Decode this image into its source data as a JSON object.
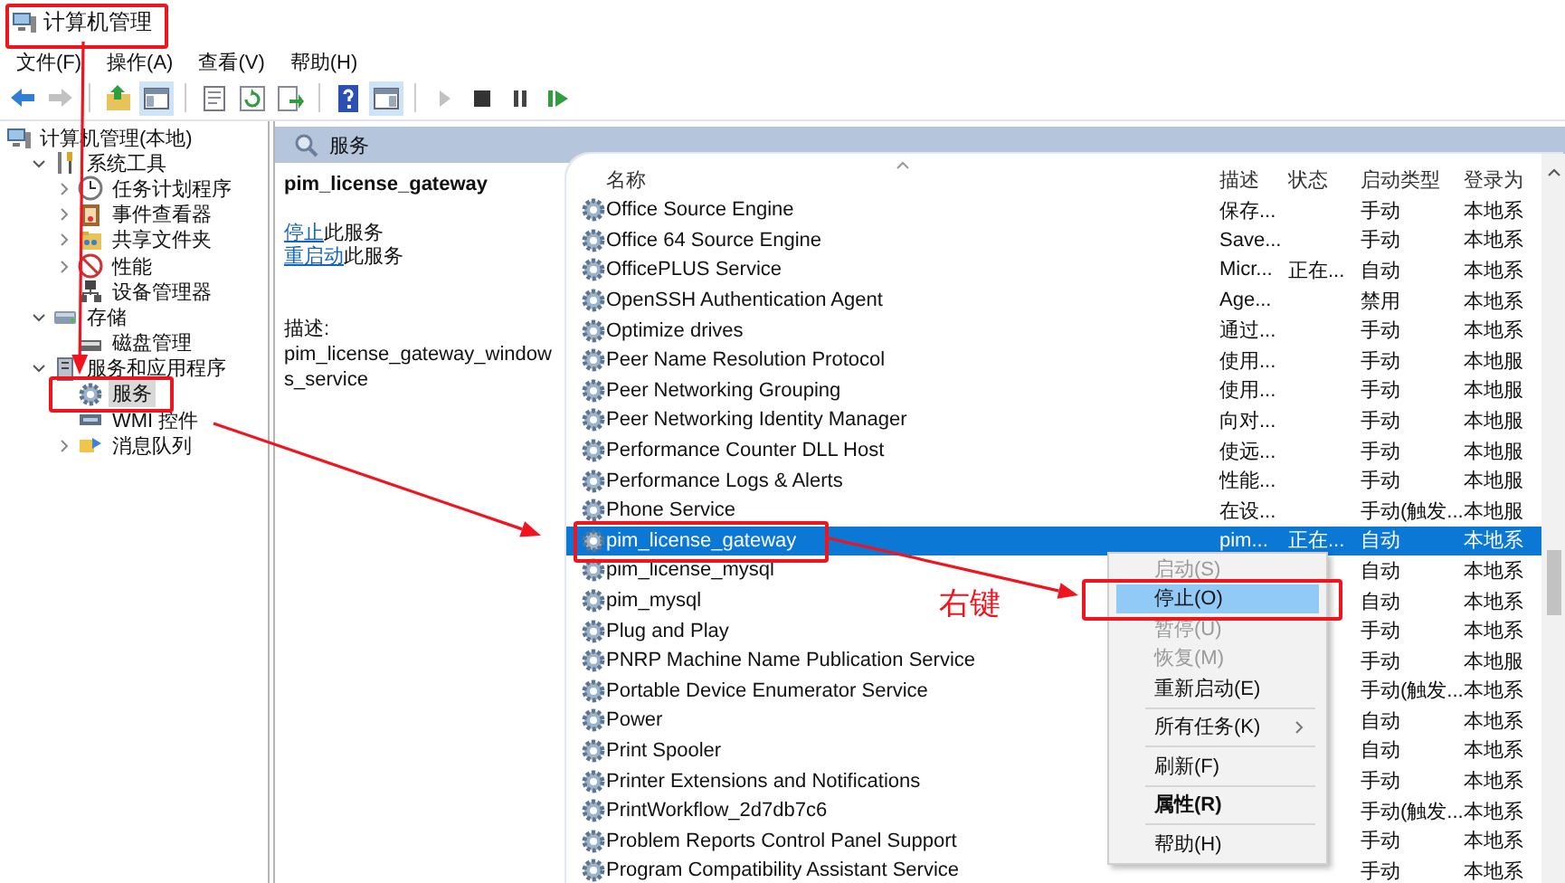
{
  "window": {
    "title": "计算机管理"
  },
  "menus": [
    "文件(F)",
    "操作(A)",
    "查看(V)",
    "帮助(H)"
  ],
  "toolbar": [
    {
      "kind": "button",
      "pressed": false,
      "disabled": false
    },
    {
      "kind": "button",
      "pressed": false,
      "disabled": true
    },
    {
      "kind": "separator"
    },
    {
      "kind": "button",
      "pressed": false,
      "disabled": false
    },
    {
      "kind": "button",
      "pressed": true,
      "disabled": false
    },
    {
      "kind": "separator"
    },
    {
      "kind": "button",
      "pressed": false,
      "disabled": false
    },
    {
      "kind": "button",
      "pressed": false,
      "disabled": false
    },
    {
      "kind": "button",
      "pressed": false,
      "disabled": false
    },
    {
      "kind": "separator"
    },
    {
      "kind": "button",
      "pressed": false,
      "disabled": false
    },
    {
      "kind": "button",
      "pressed": true,
      "disabled": false
    },
    {
      "kind": "separator"
    },
    {
      "kind": "button",
      "pressed": false,
      "disabled": true
    },
    {
      "kind": "button",
      "pressed": false,
      "disabled": false
    },
    {
      "kind": "button",
      "pressed": false,
      "disabled": false
    },
    {
      "kind": "button",
      "pressed": false,
      "disabled": false
    }
  ],
  "tree": [
    {
      "label": "计算机管理(本地)",
      "selected": false,
      "children": [
        {
          "label": "系统工具",
          "selected": false,
          "expanded": true,
          "children": [
            {
              "label": "任务计划程序",
              "selected": false,
              "expanded": false
            },
            {
              "label": "事件查看器",
              "selected": false,
              "expanded": false
            },
            {
              "label": "共享文件夹",
              "selected": false,
              "expanded": false
            },
            {
              "label": "性能",
              "selected": false,
              "expanded": false
            },
            {
              "label": "设备管理器",
              "selected": false
            }
          ]
        },
        {
          "label": "存储",
          "selected": false,
          "expanded": true,
          "children": [
            {
              "label": "磁盘管理",
              "selected": false
            }
          ]
        },
        {
          "label": "服务和应用程序",
          "selected": false,
          "expanded": true,
          "children": [
            {
              "label": "服务",
              "selected": true
            },
            {
              "label": "WMI 控件",
              "selected": false
            },
            {
              "label": "消息队列",
              "selected": false,
              "expanded": false
            }
          ]
        }
      ]
    }
  ],
  "pane": {
    "title": "服务",
    "info": {
      "service_name": "pim_license_gateway",
      "actions": [
        {
          "link": "停止",
          "text": "此服务"
        },
        {
          "link": "重启动",
          "text": "此服务"
        }
      ],
      "description_label": "描述:",
      "description": "pim_license_gateway_windows_service"
    }
  },
  "table": {
    "columns": [
      "名称",
      "描述",
      "状态",
      "启动类型",
      "登录为"
    ],
    "rows": [
      {
        "name": "Office  Source Engine",
        "description": "保存...",
        "status": "",
        "startup": "手动",
        "logon": "本地系",
        "selected": false
      },
      {
        "name": "Office 64 Source Engine",
        "description": "Save...",
        "status": "",
        "startup": "手动",
        "logon": "本地系",
        "selected": false
      },
      {
        "name": "OfficePLUS Service",
        "description": "Micr...",
        "status": "正在...",
        "startup": "自动",
        "logon": "本地系",
        "selected": false
      },
      {
        "name": "OpenSSH Authentication Agent",
        "description": "Age...",
        "status": "",
        "startup": "禁用",
        "logon": "本地系",
        "selected": false
      },
      {
        "name": "Optimize drives",
        "description": "通过...",
        "status": "",
        "startup": "手动",
        "logon": "本地系",
        "selected": false
      },
      {
        "name": "Peer Name Resolution Protocol",
        "description": "使用...",
        "status": "",
        "startup": "手动",
        "logon": "本地服",
        "selected": false
      },
      {
        "name": "Peer Networking Grouping",
        "description": "使用...",
        "status": "",
        "startup": "手动",
        "logon": "本地服",
        "selected": false
      },
      {
        "name": "Peer Networking Identity Manager",
        "description": "向对...",
        "status": "",
        "startup": "手动",
        "logon": "本地服",
        "selected": false
      },
      {
        "name": "Performance Counter DLL Host",
        "description": "使远...",
        "status": "",
        "startup": "手动",
        "logon": "本地服",
        "selected": false
      },
      {
        "name": "Performance Logs & Alerts",
        "description": "性能...",
        "status": "",
        "startup": "手动",
        "logon": "本地服",
        "selected": false
      },
      {
        "name": "Phone Service",
        "description": "在设...",
        "status": "",
        "startup": "手动(触发...",
        "logon": "本地服",
        "selected": false
      },
      {
        "name": "pim_license_gateway",
        "description": "pim...",
        "status": "正在...",
        "startup": "自动",
        "logon": "本地系",
        "selected": true
      },
      {
        "name": "pim_license_mysql",
        "startup": "自动",
        "logon": "本地系",
        "selected": false
      },
      {
        "name": "pim_mysql",
        "startup": "自动",
        "logon": "本地系",
        "selected": false
      },
      {
        "name": "Plug and Play",
        "startup": "手动",
        "logon": "本地系",
        "selected": false
      },
      {
        "name": "PNRP Machine Name Publication Service",
        "startup": "手动",
        "logon": "本地服",
        "selected": false
      },
      {
        "name": "Portable Device Enumerator Service",
        "startup": "手动(触发...",
        "logon": "本地系",
        "selected": false
      },
      {
        "name": "Power",
        "startup": "自动",
        "logon": "本地系",
        "selected": false
      },
      {
        "name": "Print Spooler",
        "startup": "自动",
        "logon": "本地系",
        "selected": false
      },
      {
        "name": "Printer Extensions and Notifications",
        "startup": "手动",
        "logon": "本地系",
        "selected": false
      },
      {
        "name": "PrintWorkflow_2d7db7c6",
        "startup": "手动(触发...",
        "logon": "本地系",
        "selected": false
      },
      {
        "name": "Problem Reports Control Panel Support",
        "startup": "手动",
        "logon": "本地系",
        "selected": false
      },
      {
        "name": "Program Compatibility Assistant Service",
        "startup": "手动",
        "logon": "本地系",
        "selected": false
      }
    ]
  },
  "context_menu": [
    {
      "kind": "item",
      "label": "启动(S)",
      "disabled": true,
      "selected": false
    },
    {
      "kind": "item",
      "label": "停止(O)",
      "disabled": false,
      "selected": true
    },
    {
      "kind": "item",
      "label": "暂停(U)",
      "disabled": true,
      "selected": false
    },
    {
      "kind": "item",
      "label": "恢复(M)",
      "disabled": true,
      "selected": false
    },
    {
      "kind": "item",
      "label": "重新启动(E)",
      "disabled": false,
      "selected": false
    },
    {
      "kind": "separator"
    },
    {
      "kind": "submenu",
      "label": "所有任务(K)",
      "disabled": false,
      "selected": false
    },
    {
      "kind": "separator"
    },
    {
      "kind": "item",
      "label": "刷新(F)",
      "disabled": false,
      "selected": false
    },
    {
      "kind": "separator"
    },
    {
      "kind": "default",
      "label": "属性(R)",
      "disabled": false,
      "selected": false
    },
    {
      "kind": "separator"
    },
    {
      "kind": "item",
      "label": "帮助(H)",
      "disabled": false,
      "selected": false
    }
  ],
  "annotation": {
    "label": "右键"
  }
}
